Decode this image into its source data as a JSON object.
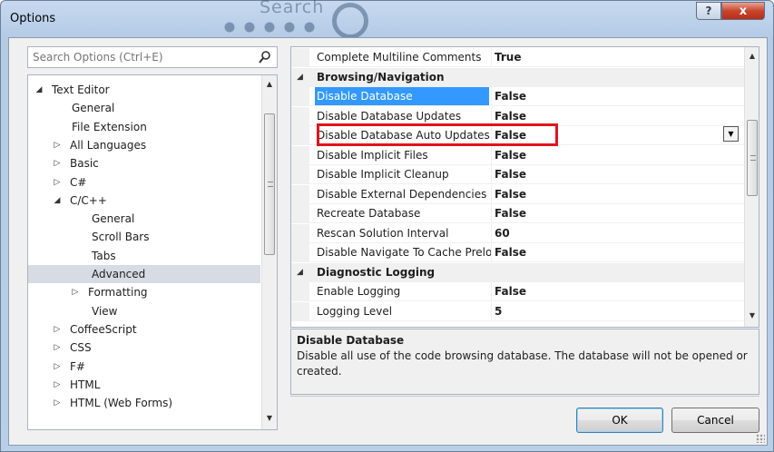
{
  "window": {
    "title": "Options",
    "help_label": "?",
    "close_label": "x",
    "deco_text": "Search"
  },
  "search": {
    "placeholder": "Search Options (Ctrl+E)"
  },
  "tree": {
    "items": [
      {
        "label": "Text Editor",
        "arrow": "◢"
      },
      {
        "label": "General",
        "arrow": ""
      },
      {
        "label": "File Extension",
        "arrow": ""
      },
      {
        "label": "All Languages",
        "arrow": "▷"
      },
      {
        "label": "Basic",
        "arrow": "▷"
      },
      {
        "label": "C#",
        "arrow": "▷"
      },
      {
        "label": "C/C++",
        "arrow": "◢"
      },
      {
        "label": "General",
        "arrow": ""
      },
      {
        "label": "Scroll Bars",
        "arrow": ""
      },
      {
        "label": "Tabs",
        "arrow": ""
      },
      {
        "label": "Advanced",
        "arrow": ""
      },
      {
        "label": "Formatting",
        "arrow": "▷"
      },
      {
        "label": "View",
        "arrow": ""
      },
      {
        "label": "CoffeeScript",
        "arrow": "▷"
      },
      {
        "label": "CSS",
        "arrow": "▷"
      },
      {
        "label": "F#",
        "arrow": "▷"
      },
      {
        "label": "HTML",
        "arrow": "▷"
      },
      {
        "label": "HTML (Web Forms)",
        "arrow": "▷"
      }
    ],
    "selected_index": 10
  },
  "grid": {
    "rows": [
      {
        "type": "property",
        "name": "Complete Multiline Comments",
        "value": "True"
      },
      {
        "type": "category",
        "name": "Browsing/Navigation",
        "arrow": "◢"
      },
      {
        "type": "property",
        "name": "Disable Database",
        "value": "False",
        "selected": true
      },
      {
        "type": "property",
        "name": "Disable Database Updates",
        "value": "False"
      },
      {
        "type": "property",
        "name": "Disable Database Auto Updates",
        "value": "False"
      },
      {
        "type": "property",
        "name": "Disable Implicit Files",
        "value": "False"
      },
      {
        "type": "property",
        "name": "Disable Implicit Cleanup",
        "value": "False"
      },
      {
        "type": "property",
        "name": "Disable External Dependencies Fo",
        "value": "False"
      },
      {
        "type": "property",
        "name": "Recreate Database",
        "value": "False"
      },
      {
        "type": "property",
        "name": "Rescan Solution Interval",
        "value": "60"
      },
      {
        "type": "property",
        "name": "Disable Navigate To Cache Prelo",
        "value": "False"
      },
      {
        "type": "category",
        "name": "Diagnostic Logging",
        "arrow": "◢"
      },
      {
        "type": "property",
        "name": "Enable Logging",
        "value": "False"
      },
      {
        "type": "property",
        "name": "Logging Level",
        "value": "5"
      }
    ],
    "dropdown_glyph": "▼"
  },
  "description": {
    "title": "Disable Database",
    "text": "Disable all use of the code browsing database.  The database will not be opened or created."
  },
  "buttons": {
    "ok_label": "OK",
    "cancel_label": "Cancel"
  },
  "scroll_glyphs": {
    "up": "▲",
    "down": "▼"
  },
  "colors": {
    "selection": "#3399ff",
    "highlight_box": "#e0141d",
    "tree_selected": "#d6dbe4"
  }
}
